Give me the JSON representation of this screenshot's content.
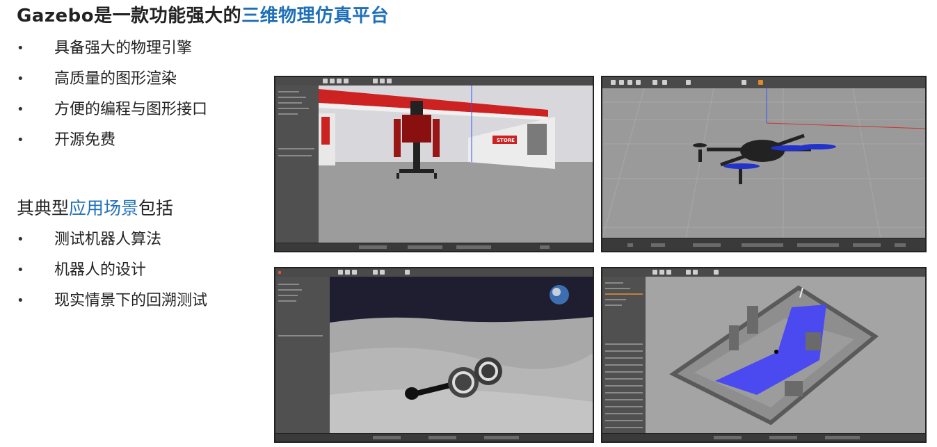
{
  "title": {
    "prefix": "Gazebo是一款功能强大的",
    "highlight": "三维物理仿真平台"
  },
  "features": [
    "具备强大的物理引擎",
    "高质量的图形渲染",
    "方便的编程与图形接口",
    "开源免费"
  ],
  "scenarios_heading": {
    "prefix": "其典型",
    "highlight": "应用场景",
    "suffix": "包括"
  },
  "scenarios": [
    "测试机器人算法",
    "机器人的设计",
    "现实情景下的回溯测试"
  ],
  "bullet_char": "•",
  "colors": {
    "accent": "#1f6fb8",
    "text": "#222222",
    "gazebo_panel": "#505050",
    "gazebo_ground": "#9a9a9a",
    "floor_blue": "#4a4af0"
  },
  "screenshots": {
    "store_sign": "STORE"
  }
}
